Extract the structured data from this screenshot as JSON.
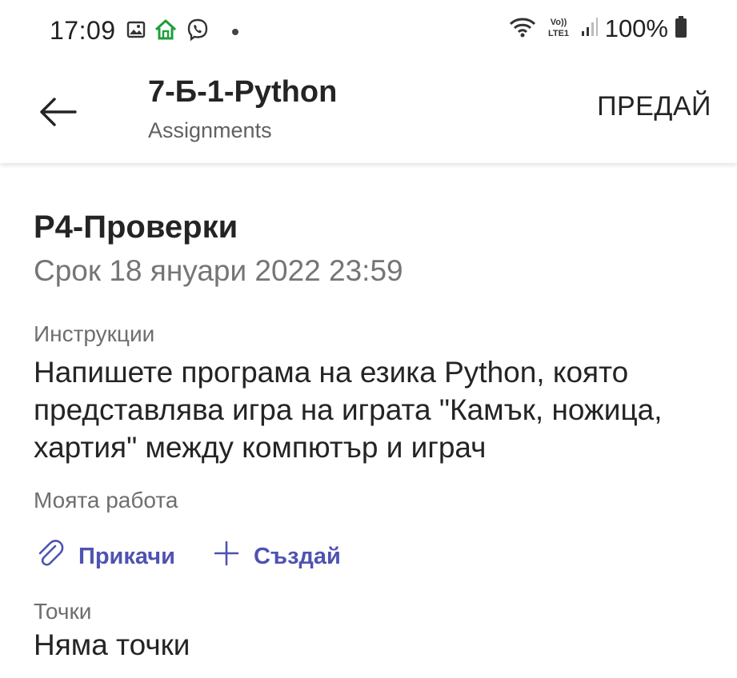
{
  "status_bar": {
    "time": "17:09",
    "battery": "100%",
    "icons": [
      "image-icon",
      "home-icon",
      "viber-icon",
      "wifi-icon",
      "volte-icon",
      "signal-icon",
      "battery-icon"
    ],
    "network_label": "Vo)) LTE1"
  },
  "app_bar": {
    "title": "7-Б-1-Python",
    "subtitle": "Assignments",
    "submit_label": "ПРЕДАЙ"
  },
  "assignment": {
    "title": "Р4-Проверки",
    "due": "Срок 18 януари 2022 23:59",
    "instructions_label": "Инструкции",
    "instructions": "Напишете програма на езика Python, която представлява игра на играта \"Камък, ножица, хартия\" между компютър и играч",
    "my_work_label": "Моята работа",
    "attach_label": "Прикачи",
    "create_label": "Създай",
    "points_label": "Точки",
    "points_value": "Няма точки"
  },
  "colors": {
    "accent": "#4f52b2",
    "home_icon": "#1e9e3a",
    "text_primary": "#242424",
    "text_secondary": "#757575"
  }
}
